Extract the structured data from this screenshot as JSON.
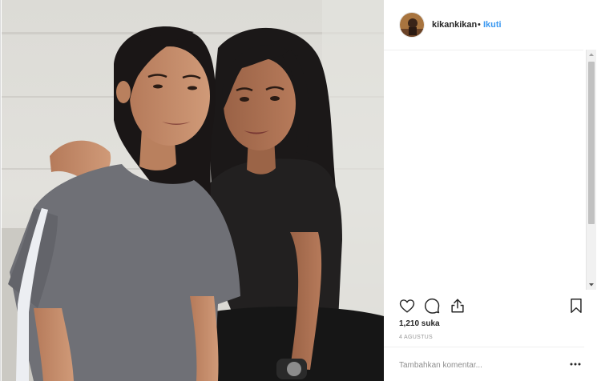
{
  "post": {
    "photo_alt": "photo",
    "username": "kikankikan",
    "separator": "•",
    "follow_label": "Ikuti"
  },
  "icons": {
    "like": "heart-icon",
    "comment": "comment-icon",
    "share": "share-icon",
    "save": "bookmark-icon",
    "more": "more-options-icon"
  },
  "stats": {
    "likes": "1,210 suka",
    "date": "4 AGUSTUS"
  },
  "comment": {
    "placeholder": "Tambahkan komentar..."
  },
  "colors": {
    "link": "#3897f0",
    "text": "#262626",
    "muted": "#999999"
  }
}
